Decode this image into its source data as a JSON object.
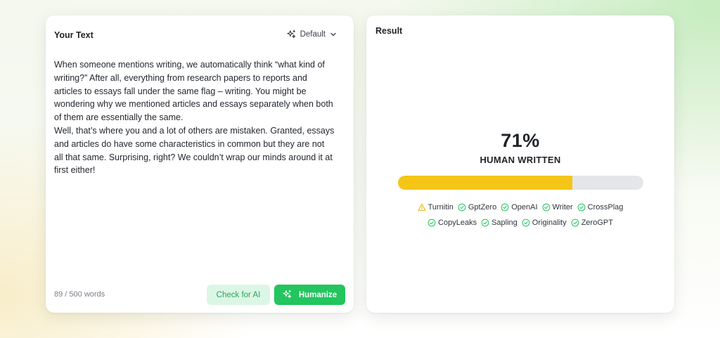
{
  "input": {
    "title": "Your Text",
    "mode_label": "Default",
    "paragraphs": [
      "When someone mentions writing, we automatically think “what kind of writing?” After all, everything from research papers to reports and articles to essays fall under the same flag – writing. You might be wondering why we mentioned articles and essays separately when both of them are essentially the same.",
      "Well, that’s where you and a lot of others are mistaken. Granted, essays and articles do have some characteristics in common but they are not all that same. Surprising, right? We couldn’t wrap our minds around it at first either!"
    ],
    "word_count": "89 / 500 words",
    "check_button": "Check for AI",
    "humanize_button": "Humanize"
  },
  "result": {
    "title": "Result",
    "score": "71%",
    "score_label": "HUMAN WRITTEN",
    "progress_fraction": 0.71,
    "colors": {
      "fill": "#f5c518",
      "track": "#e5e6ea",
      "pass": "#22c55e",
      "warn": "#eab308"
    },
    "detectors_row1": [
      {
        "name": "Turnitin",
        "status": "warning",
        "icon": "warning-icon"
      },
      {
        "name": "GptZero",
        "status": "pass",
        "icon": "check-circle-icon"
      },
      {
        "name": "OpenAI",
        "status": "pass",
        "icon": "check-circle-icon"
      },
      {
        "name": "Writer",
        "status": "pass",
        "icon": "check-circle-icon"
      },
      {
        "name": "CrossPlag",
        "status": "pass",
        "icon": "check-circle-icon"
      }
    ],
    "detectors_row2": [
      {
        "name": "CopyLeaks",
        "status": "pass",
        "icon": "check-circle-icon"
      },
      {
        "name": "Sapling",
        "status": "pass",
        "icon": "check-circle-icon"
      },
      {
        "name": "Originality",
        "status": "pass",
        "icon": "check-circle-icon"
      },
      {
        "name": "ZeroGPT",
        "status": "pass",
        "icon": "check-circle-icon"
      }
    ]
  }
}
